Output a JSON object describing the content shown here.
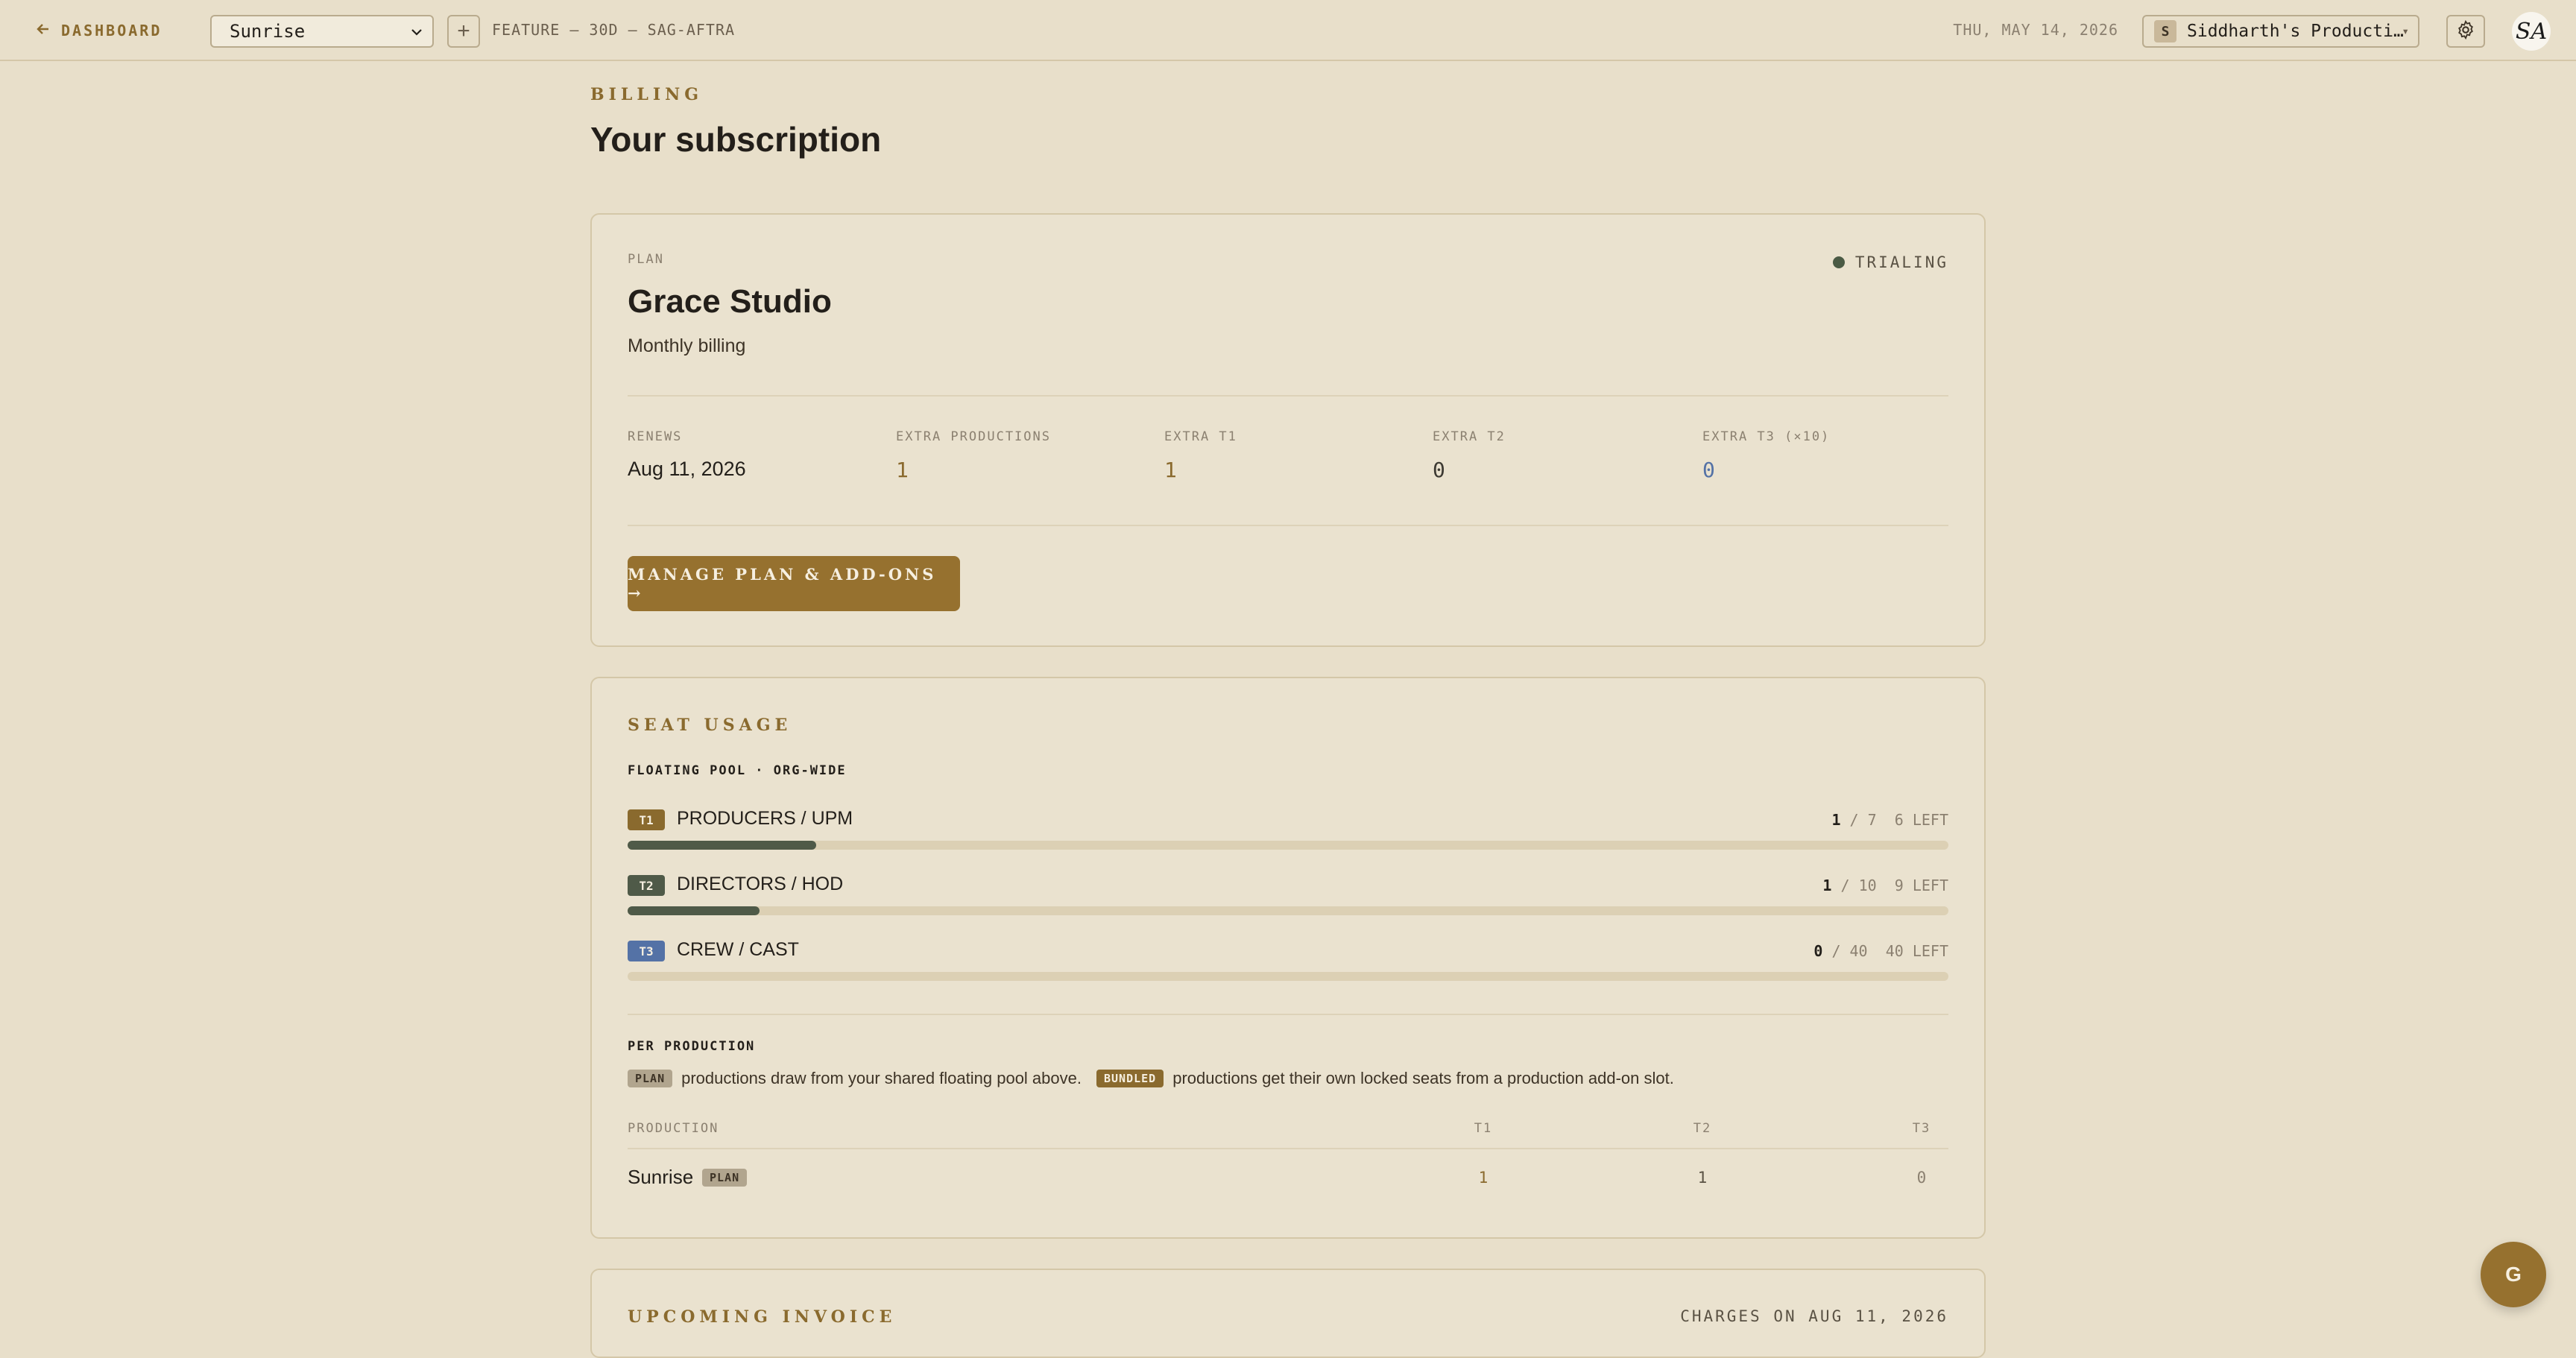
{
  "topbar": {
    "back_label": "DASHBOARD",
    "project_select": "Sunrise",
    "add_label": "+",
    "crumb": "FEATURE — 30D — SAG-AFTRA",
    "date": "THU, MAY 14, 2026",
    "org_initial": "S",
    "org_name": "Siddharth's Producti…",
    "avatar": "SA"
  },
  "page": {
    "section": "BILLING",
    "title": "Your subscription"
  },
  "plan": {
    "label": "PLAN",
    "name": "Grace Studio",
    "cycle": "Monthly billing",
    "status": "TRIALING",
    "stats": [
      {
        "label": "RENEWS",
        "value": "Aug 11, 2026"
      },
      {
        "label": "EXTRA PRODUCTIONS",
        "value": "1"
      },
      {
        "label": "EXTRA T1",
        "value": "1"
      },
      {
        "label": "EXTRA T2",
        "value": "0"
      },
      {
        "label": "EXTRA T3 (×10)",
        "value": "0"
      }
    ],
    "manage_button": "MANAGE PLAN & ADD-ONS →"
  },
  "seats": {
    "title": "SEAT USAGE",
    "pool_label": "FLOATING POOL · ORG-WIDE",
    "rows": [
      {
        "tier": "T1",
        "name": "PRODUCERS / UPM",
        "used": "1",
        "total": "/ 7",
        "left": "6 LEFT",
        "fraction": 0.143,
        "color": "#8a6a2e"
      },
      {
        "tier": "T2",
        "name": "DIRECTORS / HOD",
        "used": "1",
        "total": "/ 10",
        "left": "9 LEFT",
        "fraction": 0.1,
        "color": "#4f5a48"
      },
      {
        "tier": "T3",
        "name": "CREW / CAST",
        "used": "0",
        "total": "/ 40",
        "left": "40 LEFT",
        "fraction": 0,
        "color": "#5472a6"
      }
    ],
    "per_production_label": "PER PRODUCTION",
    "legend_plan_chip": "PLAN",
    "legend_plan_text": "productions draw from your shared floating pool above.",
    "legend_bundled_chip": "BUNDLED",
    "legend_bundled_text": "productions get their own locked seats from a production add-on slot.",
    "table_headers": [
      "PRODUCTION",
      "T1",
      "T2",
      "T3"
    ],
    "table_rows": [
      {
        "name": "Sunrise",
        "chip": "PLAN",
        "t1": "1",
        "t2": "1",
        "t3": "0"
      }
    ]
  },
  "invoice": {
    "title": "UPCOMING INVOICE",
    "charges": "CHARGES ON AUG 11, 2026"
  },
  "fab_label": "G",
  "colors": {
    "accent": "#96712f",
    "background": "#e8dfca",
    "t1": "#8a6a2e",
    "t2": "#4f5a48",
    "t3": "#5472a6"
  }
}
